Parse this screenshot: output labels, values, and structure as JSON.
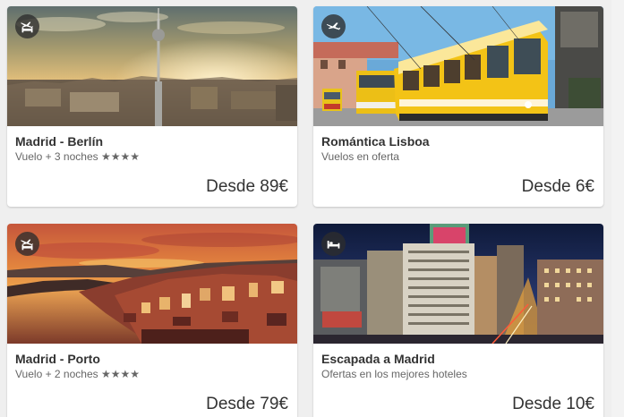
{
  "cards": [
    {
      "title": "Madrid - Berlín",
      "subtitle": "Vuelo + 3 noches ★★★★",
      "price": "Desde 89€",
      "badge_icon": "flight-hotel-icon",
      "image": "berlin-tv-tower-sunset"
    },
    {
      "title": "Romántica Lisboa",
      "subtitle": "Vuelos en oferta",
      "price": "Desde 6€",
      "badge_icon": "plane-icon",
      "image": "lisbon-yellow-tram"
    },
    {
      "title": "Madrid - Porto",
      "subtitle": "Vuelo + 2 noches ★★★★",
      "price": "Desde 79€",
      "badge_icon": "flight-hotel-icon",
      "image": "porto-river-sunset"
    },
    {
      "title": "Escapada a Madrid",
      "subtitle": "Ofertas en los mejores hoteles",
      "price": "Desde 10€",
      "badge_icon": "bed-icon",
      "image": "madrid-gran-via-night"
    }
  ],
  "colors": {
    "page_background": "#efefef",
    "card_background": "#ffffff",
    "title_text": "#333333",
    "subtitle_text": "#666666",
    "badge_background": "#2d2d2d"
  }
}
